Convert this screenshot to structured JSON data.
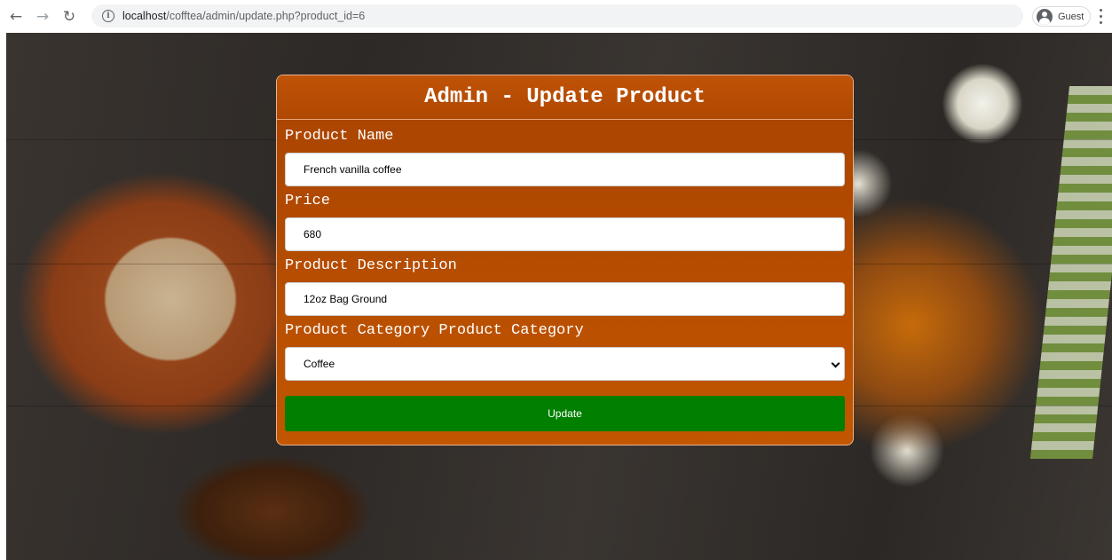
{
  "browser": {
    "url_host": "localhost",
    "url_path": "/cofftea/admin/update.php?product_id=6",
    "profile_label": "Guest"
  },
  "icons": {
    "back": "back-arrow-icon",
    "forward": "forward-arrow-icon",
    "reload": "reload-icon",
    "info": "info-icon",
    "profile": "avatar-icon",
    "menu": "kebab-menu-icon",
    "select": "chevron-down-icon"
  },
  "colors": {
    "card_orange": "#b24a00",
    "button_green": "#007f00"
  },
  "form": {
    "title": "Admin - Update Product",
    "name_label": "Product Name",
    "name_value": "French vanilla coffee",
    "price_label": "Price",
    "price_value": "680",
    "description_label": "Product Description",
    "description_value": "12oz Bag Ground",
    "category_label": "Product Category Product Category",
    "category_value": "Coffee",
    "submit_label": "Update"
  }
}
